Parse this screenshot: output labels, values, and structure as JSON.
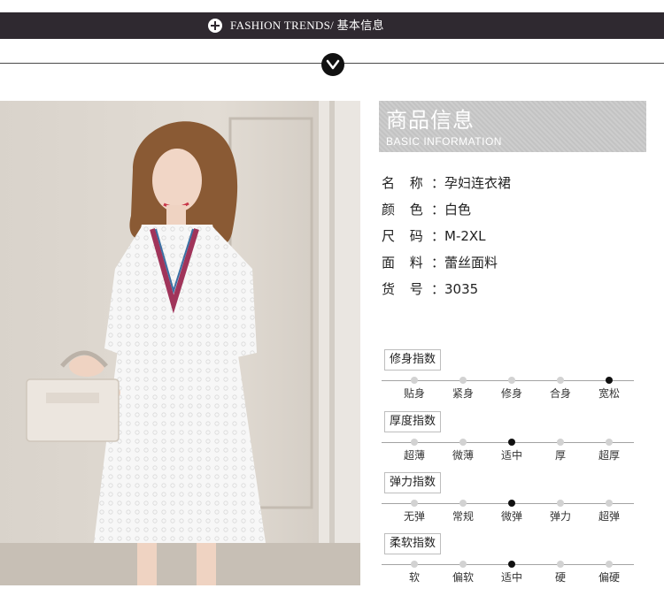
{
  "banner": {
    "text": "FASHION TRENDS/ 基本信息",
    "icon": "plus-circle-icon"
  },
  "divider": {
    "icon": "chevron-down-icon"
  },
  "photo": {
    "alt": "model-photo"
  },
  "info_header": {
    "title_cn": "商品信息",
    "title_en": "BASIC INFORMATION"
  },
  "specs": [
    {
      "label": "名 称",
      "value": "：孕妇连衣裙"
    },
    {
      "label": "颜 色",
      "value": "：白色"
    },
    {
      "label": "尺 码",
      "value": "：M-2XL"
    },
    {
      "label": "面 料",
      "value": "：蕾丝面料"
    },
    {
      "label": "货 号",
      "value": "：3035"
    }
  ],
  "ratings": [
    {
      "title": "修身指数",
      "options": [
        "贴身",
        "紧身",
        "修身",
        "合身",
        "宽松"
      ],
      "selected": 4
    },
    {
      "title": "厚度指数",
      "options": [
        "超薄",
        "微薄",
        "适中",
        "厚",
        "超厚"
      ],
      "selected": 2
    },
    {
      "title": "弹力指数",
      "options": [
        "无弹",
        "常规",
        "微弹",
        "弹力",
        "超弹"
      ],
      "selected": 2
    },
    {
      "title": "柔软指数",
      "options": [
        "软",
        "偏软",
        "适中",
        "硬",
        "偏硬"
      ],
      "selected": 2
    }
  ],
  "colors": {
    "banner_bg": "#2f2930",
    "active_dot": "#111111",
    "inactive_dot": "#d2d2d2"
  }
}
